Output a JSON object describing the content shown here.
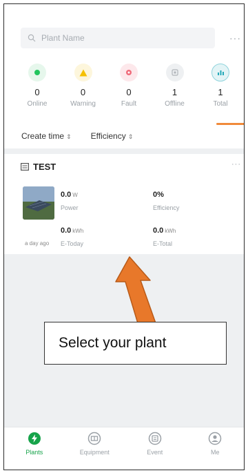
{
  "search": {
    "placeholder": "Plant Name",
    "more": "···"
  },
  "status": [
    {
      "label": "Online",
      "count": "0",
      "color": "#22c55e",
      "bg": "#e6f7ec",
      "icon": "dot-icon"
    },
    {
      "label": "Warning",
      "count": "0",
      "color": "#f5c000",
      "bg": "#fdf6dc",
      "icon": "warning-icon"
    },
    {
      "label": "Fault",
      "count": "0",
      "color": "#f06b7a",
      "bg": "#fde8eb",
      "icon": "fault-icon"
    },
    {
      "label": "Offline",
      "count": "1",
      "color": "#b0b4b9",
      "bg": "#eef0f2",
      "icon": "offline-icon"
    },
    {
      "label": "Total",
      "count": "1",
      "color": "#22a8b8",
      "bg": "#e3f4f6",
      "icon": "chart-icon"
    }
  ],
  "sort": {
    "create_time": "Create time",
    "efficiency": "Efficiency",
    "arrows": "⇕"
  },
  "plant": {
    "name": "TEST",
    "more": "···",
    "updated": "a day ago",
    "power": {
      "value": "0.0",
      "unit": "W",
      "label": "Power"
    },
    "efficiency": {
      "value": "0%",
      "label": "Efficiency"
    },
    "e_today": {
      "value": "0.0",
      "unit": "kWh",
      "label": "E-Today"
    },
    "e_total": {
      "value": "0.0",
      "unit": "kWh",
      "label": "E-Total"
    }
  },
  "annotation": {
    "text": "Select your plant",
    "arrow_color": "#e8782a"
  },
  "nav": [
    {
      "label": "Plants",
      "icon": "plant-icon",
      "active": true
    },
    {
      "label": "Equipment",
      "icon": "equipment-icon",
      "active": false
    },
    {
      "label": "Event",
      "icon": "event-icon",
      "active": false
    },
    {
      "label": "Me",
      "icon": "user-icon",
      "active": false
    }
  ]
}
